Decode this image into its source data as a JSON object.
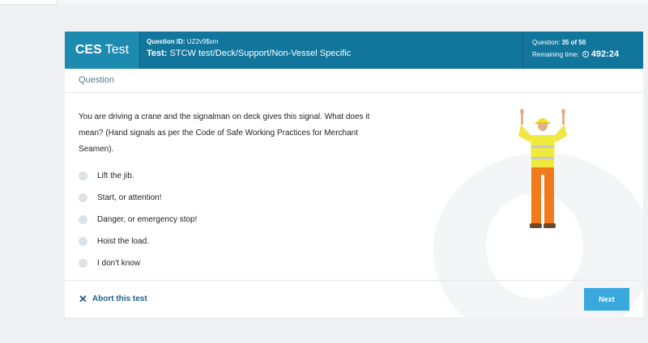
{
  "header": {
    "brand_bold": "CES",
    "brand_rest": "Test",
    "question_id_label": "Question ID:",
    "question_id": "UZ2v9$sm",
    "test_label": "Test:",
    "test_name": "STCW test/Deck/Support/Non-Vessel Specific",
    "question_label": "Question:",
    "question_count": "35 of 50",
    "remaining_label": "Remaining time:",
    "remaining_time": "492:24"
  },
  "section": {
    "title": "Question"
  },
  "question": {
    "text": "You are driving a crane and the signalman on deck gives this signal. What does it mean? (Hand signals as per the Code of Safe Working Practices for Merchant Seamen).",
    "options": [
      "Lift the jib.",
      "Start, or attention!",
      "Danger, or emergency stop!",
      "Hoist the load.",
      "I don't know"
    ]
  },
  "footer": {
    "abort_label": "Abort this test",
    "next_label": "Next"
  },
  "colors": {
    "header": "#11759c",
    "brand": "#1d8ab0",
    "next_button": "#39a8dc",
    "abort_link": "#1d5f85"
  },
  "icons": {
    "abort": "close-icon",
    "timer": "clock-icon"
  }
}
